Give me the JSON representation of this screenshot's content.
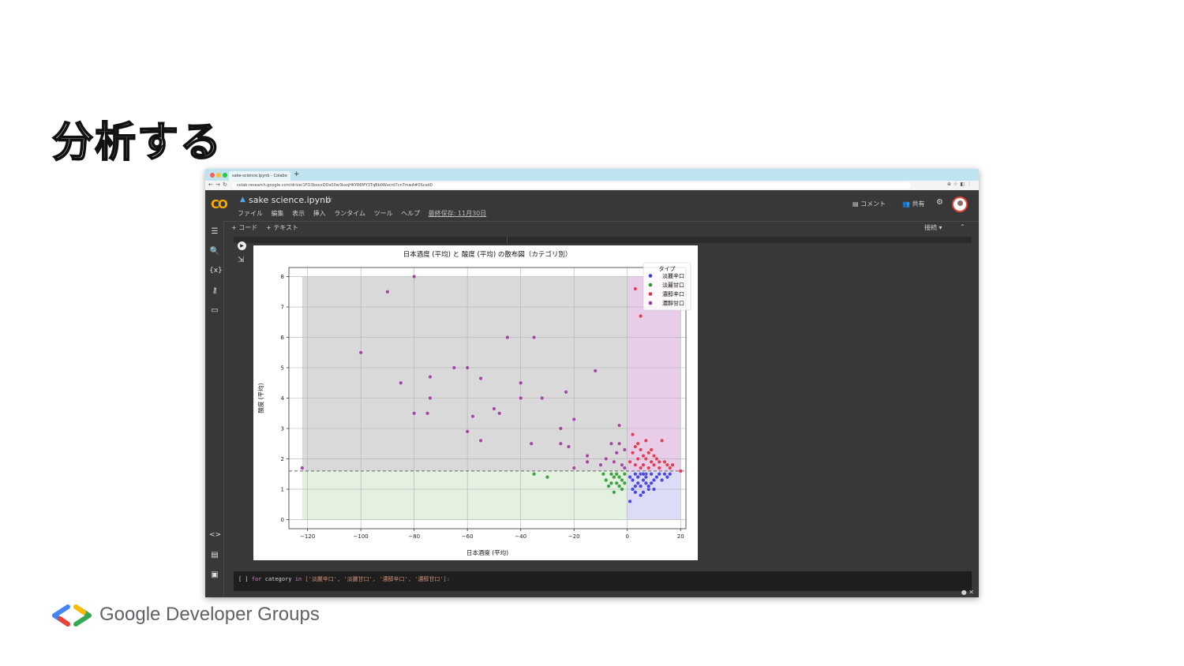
{
  "slide": {
    "title": "分析する"
  },
  "browser": {
    "tab_title": "sake-science.ipynb - Colabo",
    "new_tab": "+",
    "url": "colab.research.google.com/drive/1FO3bxxxDOx00w3kxqHKY86MY3TqBb0Wxcrd7cnTmwA#0Scxd0"
  },
  "colab": {
    "logo": "CO",
    "notebook_title": "sake science.ipynb",
    "star": "☆",
    "menu": [
      "ファイル",
      "編集",
      "表示",
      "挿入",
      "ランタイム",
      "ツール",
      "ヘルプ"
    ],
    "last_saved": "最終保存: 11月30日",
    "comment_label": "コメント",
    "share_label": "共有",
    "add_code": "+ コード",
    "add_text": "+ テキスト",
    "connect_label": "接続"
  },
  "code_cell": {
    "bracket": "[ ]",
    "keyword_for": "for",
    "var": " category ",
    "keyword_in": "in",
    "list_text": " ['淡麗辛口', '淡麗甘口', '濃醇辛口', '濃醇甘口']:"
  },
  "chart_data": {
    "type": "scatter",
    "title": "日本酒度 (平均) と 酸度 (平均) の散布図（カテゴリ別）",
    "xlabel": "日本酒度 (平均)",
    "ylabel": "酸度 (平均)",
    "xlim": [
      -127,
      22
    ],
    "ylim": [
      -0.3,
      8.3
    ],
    "xticks": [
      -120,
      -100,
      -80,
      -60,
      -40,
      -20,
      0,
      20
    ],
    "yticks": [
      0,
      1,
      2,
      3,
      4,
      5,
      6,
      7,
      8
    ],
    "grid": true,
    "reference_line_y": 1.6,
    "legend_title": "タイプ",
    "legend_position": "top-right",
    "regions": [
      {
        "x": [
          -122,
          0
        ],
        "y": [
          1.6,
          8
        ],
        "color": "#d9d9d9"
      },
      {
        "x": [
          -122,
          0
        ],
        "y": [
          0,
          1.6
        ],
        "color": "#e4f1e1"
      },
      {
        "x": [
          0,
          20
        ],
        "y": [
          1.6,
          8
        ],
        "color": "#e8cde8"
      },
      {
        "x": [
          0,
          20
        ],
        "y": [
          0,
          1.6
        ],
        "color": "#dcdcf6"
      }
    ],
    "series": [
      {
        "name": "淡麗辛口",
        "color": "#3a3ae0",
        "points": [
          [
            1,
            0.6
          ],
          [
            2,
            1.0
          ],
          [
            3,
            0.9
          ],
          [
            4,
            1.2
          ],
          [
            5,
            1.1
          ],
          [
            6,
            1.3
          ],
          [
            7,
            1.4
          ],
          [
            8,
            1.0
          ],
          [
            9,
            1.2
          ],
          [
            10,
            1.3
          ],
          [
            3,
            1.5
          ],
          [
            5,
            1.5
          ],
          [
            7,
            1.5
          ],
          [
            11,
            1.4
          ],
          [
            12,
            1.5
          ],
          [
            13,
            1.3
          ],
          [
            15,
            1.4
          ],
          [
            16,
            1.5
          ],
          [
            2,
            1.3
          ],
          [
            4,
            1.4
          ],
          [
            6,
            0.9
          ],
          [
            8,
            1.1
          ],
          [
            10,
            1.0
          ],
          [
            1,
            1.4
          ],
          [
            9,
            1.5
          ],
          [
            14,
            1.5
          ],
          [
            5,
            0.8
          ],
          [
            3,
            1.1
          ],
          [
            6,
            1.5
          ],
          [
            7,
            1.2
          ]
        ]
      },
      {
        "name": "淡麗甘口",
        "color": "#2e9a2e",
        "points": [
          [
            -35,
            1.5
          ],
          [
            -30,
            1.4
          ],
          [
            -9,
            1.5
          ],
          [
            -8,
            1.3
          ],
          [
            -6,
            1.2
          ],
          [
            -5,
            1.4
          ],
          [
            -4,
            1.5
          ],
          [
            -3,
            1.1
          ],
          [
            -2,
            1.3
          ],
          [
            -1,
            1.2
          ],
          [
            -7,
            1.1
          ],
          [
            -3,
            1.4
          ],
          [
            -5,
            0.9
          ],
          [
            -1,
            1.5
          ],
          [
            -2,
            1.0
          ],
          [
            -4,
            1.2
          ],
          [
            -6,
            1.5
          ]
        ]
      },
      {
        "name": "濃醇辛口",
        "color": "#e0304a",
        "points": [
          [
            3,
            7.6
          ],
          [
            5,
            6.7
          ],
          [
            2,
            2.8
          ],
          [
            3,
            2.4
          ],
          [
            4,
            2.5
          ],
          [
            5,
            2.3
          ],
          [
            6,
            2.1
          ],
          [
            7,
            2.0
          ],
          [
            8,
            2.2
          ],
          [
            9,
            1.9
          ],
          [
            10,
            1.8
          ],
          [
            11,
            2.0
          ],
          [
            12,
            1.7
          ],
          [
            13,
            2.6
          ],
          [
            14,
            1.9
          ],
          [
            15,
            1.8
          ],
          [
            16,
            1.7
          ],
          [
            17,
            1.8
          ],
          [
            20,
            1.6
          ],
          [
            1,
            1.9
          ],
          [
            2,
            2.2
          ],
          [
            3,
            1.8
          ],
          [
            4,
            2.0
          ],
          [
            6,
            1.8
          ],
          [
            7,
            2.6
          ],
          [
            8,
            1.7
          ],
          [
            10,
            2.1
          ],
          [
            12,
            1.9
          ],
          [
            5,
            1.7
          ],
          [
            9,
            2.3
          ]
        ]
      },
      {
        "name": "濃醇甘口",
        "color": "#9b3a9b",
        "points": [
          [
            -122,
            1.7
          ],
          [
            -100,
            5.5
          ],
          [
            -90,
            7.5
          ],
          [
            -85,
            4.5
          ],
          [
            -80,
            8.0
          ],
          [
            -80,
            3.5
          ],
          [
            -75,
            3.5
          ],
          [
            -74,
            4.7
          ],
          [
            -74,
            4.0
          ],
          [
            -65,
            5.0
          ],
          [
            -60,
            5.0
          ],
          [
            -60,
            2.9
          ],
          [
            -58,
            3.4
          ],
          [
            -55,
            4.65
          ],
          [
            -55,
            2.6
          ],
          [
            -50,
            3.65
          ],
          [
            -48,
            3.5
          ],
          [
            -45,
            6.0
          ],
          [
            -40,
            4.5
          ],
          [
            -40,
            4.0
          ],
          [
            -36,
            2.5
          ],
          [
            -35,
            6.0
          ],
          [
            -32,
            4.0
          ],
          [
            -25,
            2.5
          ],
          [
            -25,
            3.0
          ],
          [
            -23,
            4.2
          ],
          [
            -22,
            2.4
          ],
          [
            -20,
            3.3
          ],
          [
            -20,
            1.7
          ],
          [
            -15,
            2.1
          ],
          [
            -15,
            1.9
          ],
          [
            -12,
            4.9
          ],
          [
            -10,
            1.8
          ],
          [
            -8,
            2.0
          ],
          [
            -6,
            2.5
          ],
          [
            -5,
            1.9
          ],
          [
            -4,
            2.2
          ],
          [
            -3,
            3.1
          ],
          [
            -2,
            1.8
          ],
          [
            -1,
            2.3
          ],
          [
            -3,
            2.5
          ],
          [
            -1,
            1.7
          ]
        ]
      }
    ]
  }
}
